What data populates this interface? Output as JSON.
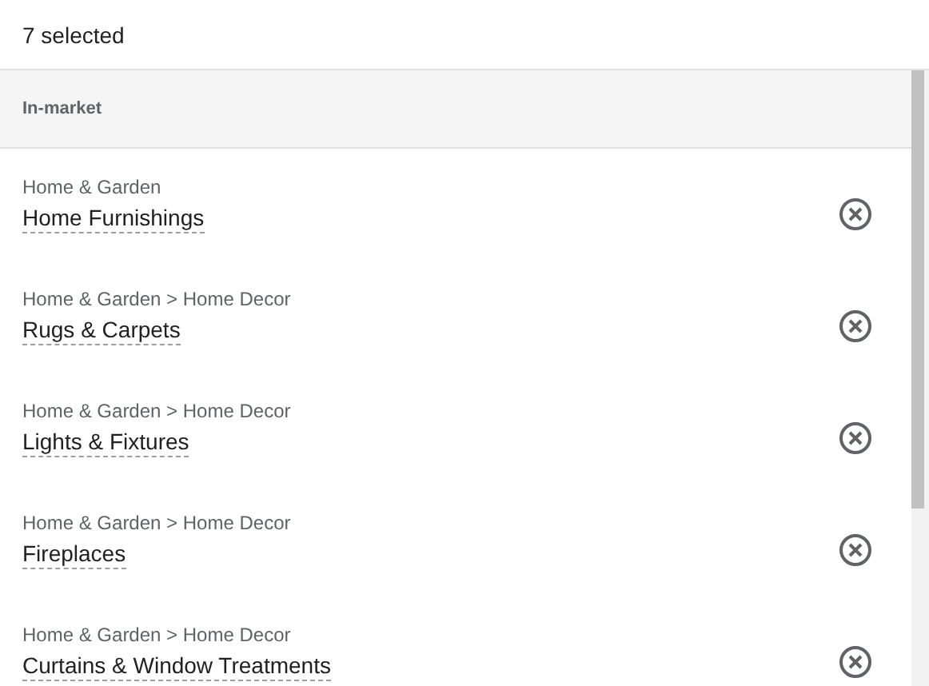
{
  "header": {
    "title": "7 selected"
  },
  "section": {
    "title": "In-market"
  },
  "items": [
    {
      "category": "Home & Garden",
      "name": "Home Furnishings"
    },
    {
      "category": "Home & Garden > Home Decor",
      "name": "Rugs & Carpets"
    },
    {
      "category": "Home & Garden > Home Decor",
      "name": "Lights & Fixtures"
    },
    {
      "category": "Home & Garden > Home Decor",
      "name": "Fireplaces"
    },
    {
      "category": "Home & Garden > Home Decor",
      "name": "Curtains & Window Treatments"
    }
  ]
}
